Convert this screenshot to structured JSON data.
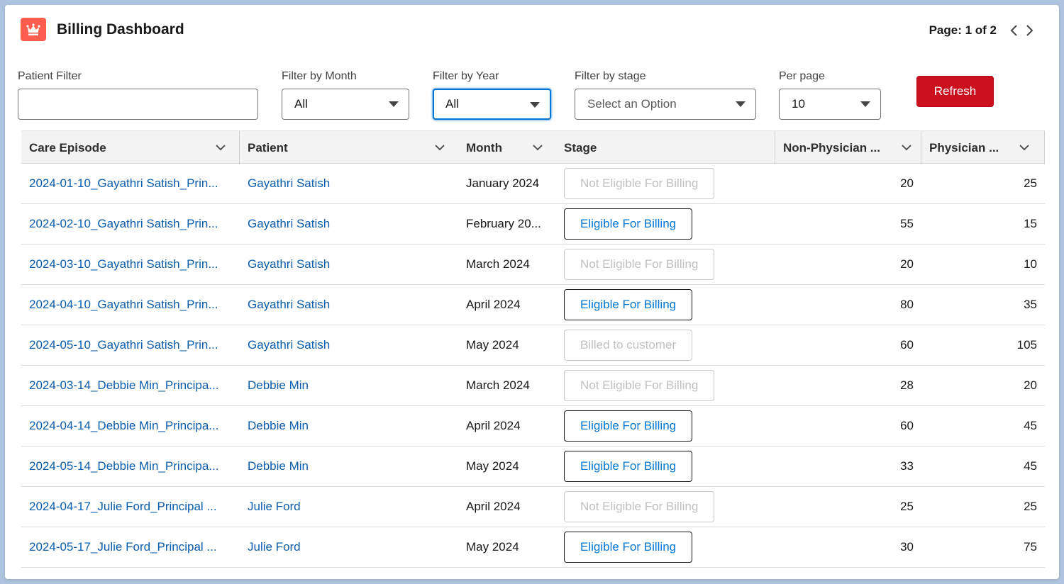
{
  "header": {
    "title": "Billing Dashboard",
    "page_info": "Page: 1 of 2"
  },
  "filters": {
    "patient": {
      "label": "Patient Filter",
      "value": ""
    },
    "month": {
      "label": "Filter by Month",
      "value": "All"
    },
    "year": {
      "label": "Filter by Year",
      "value": "All"
    },
    "stage": {
      "label": "Filter by stage",
      "placeholder": "Select an Option"
    },
    "per_page": {
      "label": "Per page",
      "value": "10"
    },
    "refresh_label": "Refresh"
  },
  "table": {
    "columns": [
      "Care Episode",
      "Patient",
      "Month",
      "Stage",
      "Non-Physician ...",
      "Physician ..."
    ],
    "rows": [
      {
        "episode": "2024-01-10_Gayathri Satish_Prin...",
        "patient": "Gayathri Satish",
        "month": "January 2024",
        "stage": "Not Eligible For Billing",
        "stage_enabled": false,
        "non_physician": "20",
        "physician": "25"
      },
      {
        "episode": "2024-02-10_Gayathri Satish_Prin...",
        "patient": "Gayathri Satish",
        "month": "February 20...",
        "stage": "Eligible For Billing",
        "stage_enabled": true,
        "non_physician": "55",
        "physician": "15"
      },
      {
        "episode": "2024-03-10_Gayathri Satish_Prin...",
        "patient": "Gayathri Satish",
        "month": "March 2024",
        "stage": "Not Eligible For Billing",
        "stage_enabled": false,
        "non_physician": "20",
        "physician": "10"
      },
      {
        "episode": "2024-04-10_Gayathri Satish_Prin...",
        "patient": "Gayathri Satish",
        "month": "April 2024",
        "stage": "Eligible For Billing",
        "stage_enabled": true,
        "non_physician": "80",
        "physician": "35"
      },
      {
        "episode": "2024-05-10_Gayathri Satish_Prin...",
        "patient": "Gayathri Satish",
        "month": "May 2024",
        "stage": "Billed to customer",
        "stage_enabled": false,
        "non_physician": "60",
        "physician": "105"
      },
      {
        "episode": "2024-03-14_Debbie Min_Principa...",
        "patient": "Debbie Min",
        "month": "March 2024",
        "stage": "Not Eligible For Billing",
        "stage_enabled": false,
        "non_physician": "28",
        "physician": "20"
      },
      {
        "episode": "2024-04-14_Debbie Min_Principa...",
        "patient": "Debbie Min",
        "month": "April 2024",
        "stage": "Eligible For Billing",
        "stage_enabled": true,
        "non_physician": "60",
        "physician": "45"
      },
      {
        "episode": "2024-05-14_Debbie Min_Principa...",
        "patient": "Debbie Min",
        "month": "May 2024",
        "stage": "Eligible For Billing",
        "stage_enabled": true,
        "non_physician": "33",
        "physician": "45"
      },
      {
        "episode": "2024-04-17_Julie Ford_Principal ...",
        "patient": "Julie Ford",
        "month": "April 2024",
        "stage": "Not Eligible For Billing",
        "stage_enabled": false,
        "non_physician": "25",
        "physician": "25"
      },
      {
        "episode": "2024-05-17_Julie Ford_Principal ...",
        "patient": "Julie Ford",
        "month": "May 2024",
        "stage": "Eligible For Billing",
        "stage_enabled": true,
        "non_physician": "30",
        "physician": "75"
      }
    ]
  },
  "icons": {
    "app": "crown-icon",
    "prev": "chevron-left-icon",
    "next": "chevron-right-icon",
    "sort": "chevron-down-icon",
    "dropdown": "caret-down-icon"
  },
  "colors": {
    "app_icon": "#fe5c4c",
    "refresh": "#c9121e",
    "link": "#0b5cab",
    "focus": "#0176d3"
  }
}
